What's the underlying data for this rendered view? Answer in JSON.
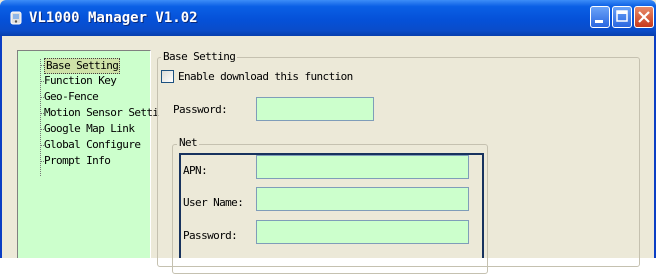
{
  "window": {
    "title": "VL1000 Manager V1.02",
    "title_color": "#ffffff",
    "titlebar_color": "#0551d8"
  },
  "tree": {
    "items": [
      {
        "label": "Base Setting",
        "selected": true
      },
      {
        "label": "Function Key"
      },
      {
        "label": "Geo-Fence"
      },
      {
        "label": "Motion Sensor Setti"
      },
      {
        "label": "Google Map Link"
      },
      {
        "label": "Global Configure"
      },
      {
        "label": "Prompt Info"
      }
    ],
    "background": "#ccffcc"
  },
  "base_setting": {
    "group_title": "Base Setting",
    "enable_label": "Enable download this function",
    "password_label": "Password:",
    "password_value": ""
  },
  "net": {
    "group_title": "Net",
    "apn_label": "APN:",
    "apn_value": "",
    "user_label": "User Name:",
    "user_value": "",
    "password_label": "Password:",
    "password_value": ""
  },
  "colors": {
    "field_bg": "#ccffcc",
    "highlight_border": "#17325e"
  },
  "icons": {
    "app": "app-logo-icon",
    "minimize": "minimize-icon",
    "maximize": "maximize-icon",
    "close": "close-icon"
  }
}
